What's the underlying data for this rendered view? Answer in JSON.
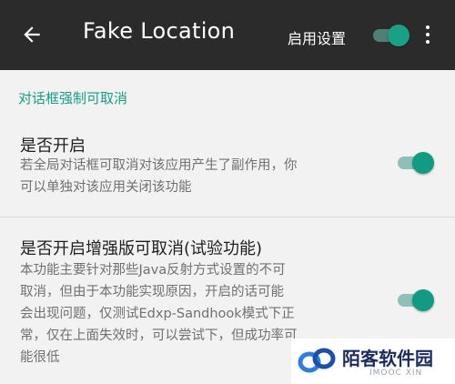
{
  "appbar": {
    "title": "Fake Location",
    "enable_label": "启用设置",
    "enable_on": true,
    "back_icon": "arrow-left-icon",
    "overflow_icon": "more-vert-icon"
  },
  "section": {
    "header": "对话框强制可取消"
  },
  "items": [
    {
      "title": "是否开启",
      "summary_lines": [
        "若全局对话框可取消对该应用产生了副作用，你",
        "可以单独对该应用关闭该功能"
      ],
      "enabled": true
    },
    {
      "title": "是否开启增强版可取消(试验功能)",
      "summary_lines": [
        "本功能主要针对那些Java反射方式设置的不可",
        "取消，但由于本功能实现原因，开启的话可能",
        "会出现问题，仅测试Edxp-Sandhook模式下正",
        "常，仅在上面失效时，可以尝试下，但成功率可",
        "能很低"
      ],
      "enabled": true
    }
  ],
  "watermark": {
    "text": "陌客软件园",
    "sub": "IMOOC XIN"
  },
  "colors": {
    "appbar": "#2b2b2b",
    "accent": "#129b83",
    "background": "#f2f2f2"
  }
}
